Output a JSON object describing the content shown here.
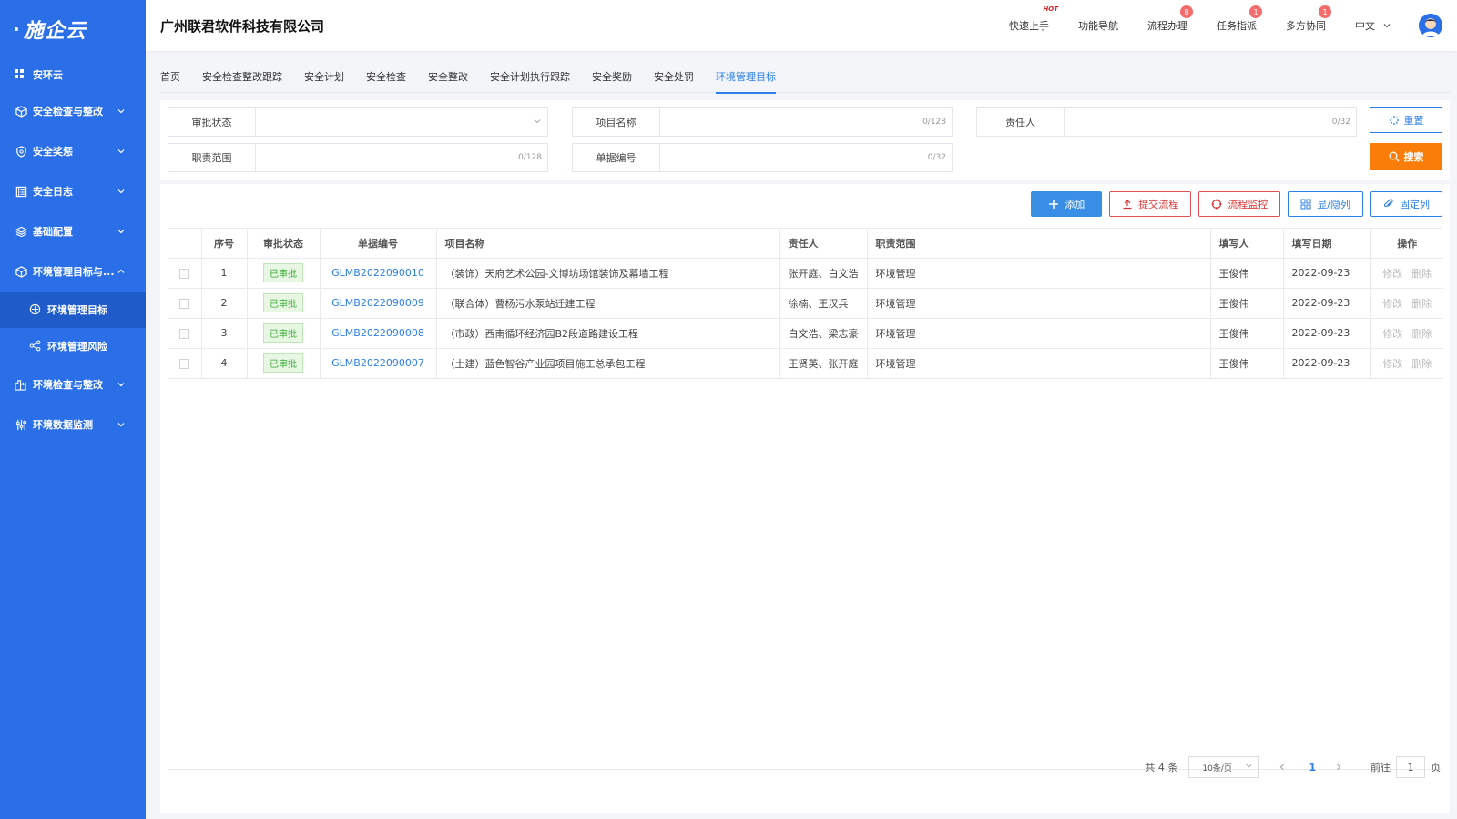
{
  "sidebar": {
    "logo": "施企云",
    "top": "安环云",
    "items": [
      {
        "label": "安全检查与整改"
      },
      {
        "label": "安全奖惩"
      },
      {
        "label": "安全日志"
      },
      {
        "label": "基础配置"
      },
      {
        "label": "环境管理目标与..."
      }
    ],
    "sub_items": [
      {
        "label": "环境管理目标"
      },
      {
        "label": "环境管理风险"
      }
    ],
    "items2": [
      {
        "label": "环境检查与整改"
      },
      {
        "label": "环境数据监测"
      }
    ]
  },
  "header": {
    "company": "广州联君软件科技有限公司",
    "links": [
      {
        "label": "快速上手",
        "tag": "HOT"
      },
      {
        "label": "功能导航"
      },
      {
        "label": "流程办理",
        "badge": "8"
      },
      {
        "label": "任务指派",
        "badge": "1"
      },
      {
        "label": "多方协同",
        "badge": "1"
      }
    ],
    "lang": "中文"
  },
  "tabs": [
    "首页",
    "安全检查整改跟踪",
    "安全计划",
    "安全检查",
    "安全整改",
    "安全计划执行跟踪",
    "安全奖励",
    "安全处罚",
    "环境管理目标"
  ],
  "filters": {
    "approval_status": {
      "label": "审批状态",
      "value": ""
    },
    "project_name": {
      "label": "项目名称",
      "count": "0/128"
    },
    "owner": {
      "label": "责任人",
      "count": "0/32"
    },
    "scope": {
      "label": "职责范围",
      "count": "0/128"
    },
    "doc_no": {
      "label": "单据编号",
      "count": "0/32"
    },
    "reset": "重置",
    "search": "搜索"
  },
  "toolbar": {
    "add": "添加",
    "submit": "提交流程",
    "monitor": "流程监控",
    "toggle_cols": "显/隐列",
    "pin_cols": "固定列"
  },
  "table": {
    "headers": [
      "序号",
      "审批状态",
      "单据编号",
      "项目名称",
      "责任人",
      "职责范围",
      "填写人",
      "填写日期",
      "操作"
    ],
    "rows": [
      {
        "no": "1",
        "status": "已审批",
        "doc": "GLMB2022090010",
        "project": "（装饰）天府艺术公园-文博坊场馆装饰及幕墙工程",
        "owner": "张开庭、白文浩",
        "scope": "环境管理",
        "writer": "王俊伟",
        "date": "2022-09-23"
      },
      {
        "no": "2",
        "status": "已审批",
        "doc": "GLMB2022090009",
        "project": "（联合体）曹杨污水泵站迁建工程",
        "owner": "徐楠、王汉兵",
        "scope": "环境管理",
        "writer": "王俊伟",
        "date": "2022-09-23"
      },
      {
        "no": "3",
        "status": "已审批",
        "doc": "GLMB2022090008",
        "project": "（市政）西南循环经济园B2段道路建设工程",
        "owner": "白文浩、梁志豪",
        "scope": "环境管理",
        "writer": "王俊伟",
        "date": "2022-09-23"
      },
      {
        "no": "4",
        "status": "已审批",
        "doc": "GLMB2022090007",
        "project": "（土建）蓝色智谷产业园项目施工总承包工程",
        "owner": "王贤英、张开庭",
        "scope": "环境管理",
        "writer": "王俊伟",
        "date": "2022-09-23"
      }
    ],
    "op_edit": "修改",
    "op_delete": "删除"
  },
  "pager": {
    "total": "共 4 条",
    "page_size": "10条/页",
    "current": "1",
    "goto_pre": "前往",
    "goto_val": "1",
    "goto_post": "页"
  }
}
